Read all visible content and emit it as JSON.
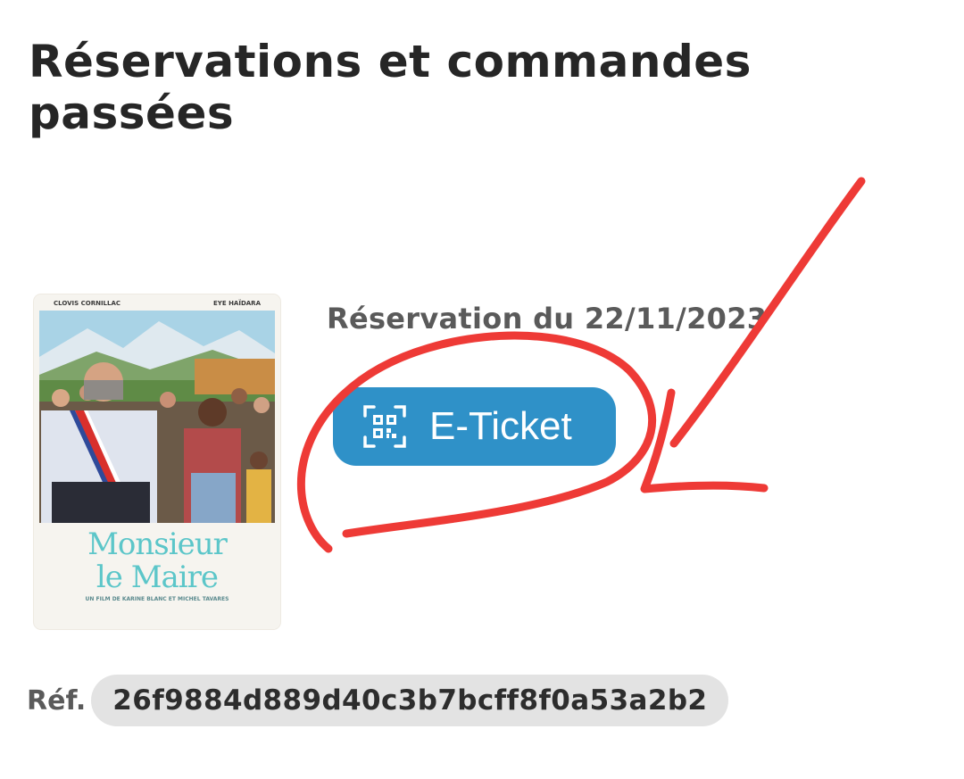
{
  "header": {
    "title": "Réservations et commandes passées"
  },
  "booking": {
    "date_label": "Réservation du 22/11/2023",
    "poster": {
      "cast_left": "CLOVIS CORNILLAC",
      "cast_right": "EYE HAÏDARA",
      "title_line1": "Monsieur",
      "title_line2": "le Maire",
      "credits": "UN FILM DE KARINE BLANC ET MICHEL TAVARES"
    },
    "eticket_button": {
      "label": "E-Ticket",
      "icon": "qr-code-icon",
      "color": "#2f91c8"
    },
    "reference": {
      "label": "Réf.",
      "value": "26f9884d889d40c3b7bcff8f0a53a2b2"
    }
  },
  "annotation": {
    "color": "#ee3a36",
    "shapes": [
      "circle-around-eticket",
      "arrow-pointing-to-eticket"
    ]
  }
}
